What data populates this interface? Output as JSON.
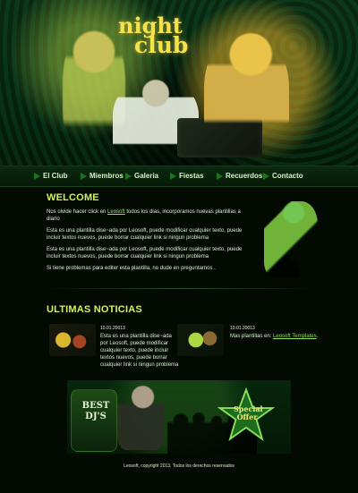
{
  "header": {
    "logo_top": "night",
    "logo_bottom": "club"
  },
  "nav": {
    "items": [
      "El Club",
      "Miembros",
      "Galeria",
      "Fiestas",
      "Recuerdos",
      "Contacto"
    ]
  },
  "welcome": {
    "title": "WELCOME",
    "p1_before": "Nos olvide hacer click en ",
    "p1_link": "Leosoft",
    "p1_after": " todos los dias, incorporamos nuevas plantillas a diario",
    "p2": "Esta es una plantilla dise~ada por Leosoft, puede modificar cualquier texto, puede incluir textos nuevos, puede borrar cualquier link si ningun problema",
    "p3": "Esta es una plantilla dise~ada por Leosoft, puede modificar cualquier texto, puede incluir textos nuevos, puede borrar cualquier link si ningun problema",
    "p4": "Si tiene problemas para editer esta plantilla, no dude en preguntarnos ."
  },
  "news": {
    "title": "ULTIMAS NOTICIAS",
    "item1_date": "10.01.20013",
    "item1_text": "Esta es una plantilla dise~ada por Leosoft, puede modificar cualquier texto, puede incluir textos nuevos, puede borrar cualquier link si ningun problema",
    "item2_date": "10.01.20013",
    "item2_text_before": "Mas plantillas en: ",
    "item2_link": "Leosoft Templates",
    "item2_text_after": "."
  },
  "banner": {
    "best": "BEST",
    "djs": "DJ'S",
    "special": "Special",
    "offer": "Offer"
  },
  "footer": {
    "text": "Leosoft, copyright 2013. Todos los derechos reservados"
  },
  "colors": {
    "accent": "#d7f05a",
    "link": "#91e35c",
    "background": "#020a02"
  }
}
